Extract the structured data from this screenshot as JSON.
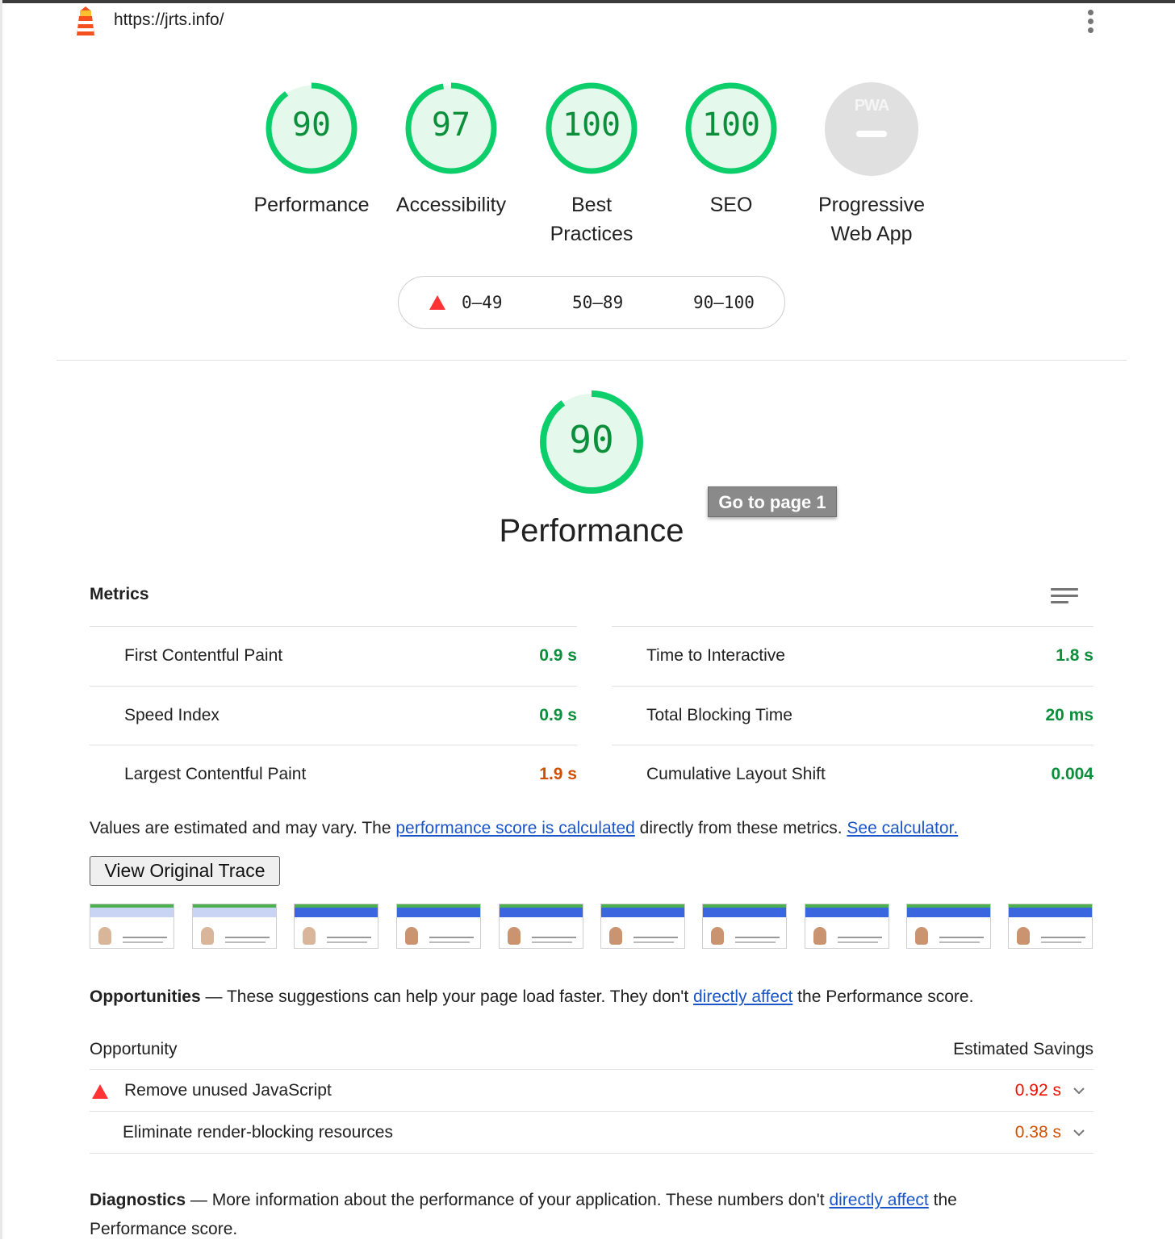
{
  "topbar": {
    "url": "https://jrts.info/",
    "logo_icon": "lighthouse-icon",
    "menu_icon": "vertical-dots-icon"
  },
  "gauges": [
    {
      "score": "90",
      "label": "Performance",
      "fraction": 0.9
    },
    {
      "score": "97",
      "label": "Accessibility",
      "fraction": 0.97
    },
    {
      "score": "100",
      "label": "Best Practices",
      "fraction": 1.0
    },
    {
      "score": "100",
      "label": "SEO",
      "fraction": 1.0
    },
    {
      "badge": "PWA",
      "label": "Progressive Web App"
    }
  ],
  "legend": {
    "fail": "0–49",
    "average": "50–89",
    "pass": "90–100"
  },
  "performance": {
    "score": "90",
    "fraction": 0.9,
    "title": "Performance",
    "tooltip": "Go to page 1"
  },
  "metrics": {
    "title": "Metrics",
    "items": [
      {
        "label": "First Contentful Paint",
        "value": "0.9 s",
        "status": "pass"
      },
      {
        "label": "Time to Interactive",
        "value": "1.8 s",
        "status": "pass"
      },
      {
        "label": "Speed Index",
        "value": "0.9 s",
        "status": "pass"
      },
      {
        "label": "Total Blocking Time",
        "value": "20 ms",
        "status": "pass"
      },
      {
        "label": "Largest Contentful Paint",
        "value": "1.9 s",
        "status": "average"
      },
      {
        "label": "Cumulative Layout Shift",
        "value": "0.004",
        "status": "pass"
      }
    ],
    "note_pre": "Values are estimated and may vary. The ",
    "note_link1": "performance score is calculated",
    "note_mid": " directly from these metrics.",
    "note_link2": "See calculator.",
    "trace_button": "View Original Trace"
  },
  "opportunities": {
    "title": "Opportunities",
    "dash": "—",
    "desc_pre": "These suggestions can help your page load faster. They don't ",
    "desc_link": "directly affect",
    "desc_post": " the Performance score.",
    "col_left": "Opportunity",
    "col_right": "Estimated Savings",
    "items": [
      {
        "label": "Remove unused JavaScript",
        "value": "0.92 s",
        "status": "fail"
      },
      {
        "label": "Eliminate render-blocking resources",
        "value": "0.38 s",
        "status": "average"
      }
    ]
  },
  "diagnostics": {
    "title": "Diagnostics",
    "dash": "—",
    "desc_pre": "More information about the performance of your application. These numbers don't ",
    "desc_link": "directly affect",
    "desc_post": " the Performance score."
  },
  "colors": {
    "pass": "#0c8f3b",
    "pass_bg": "#e5f8ec",
    "ring": "#0cce6b",
    "average": "#d44e00",
    "fail": "#eb0f00",
    "link": "#1a55c9"
  }
}
